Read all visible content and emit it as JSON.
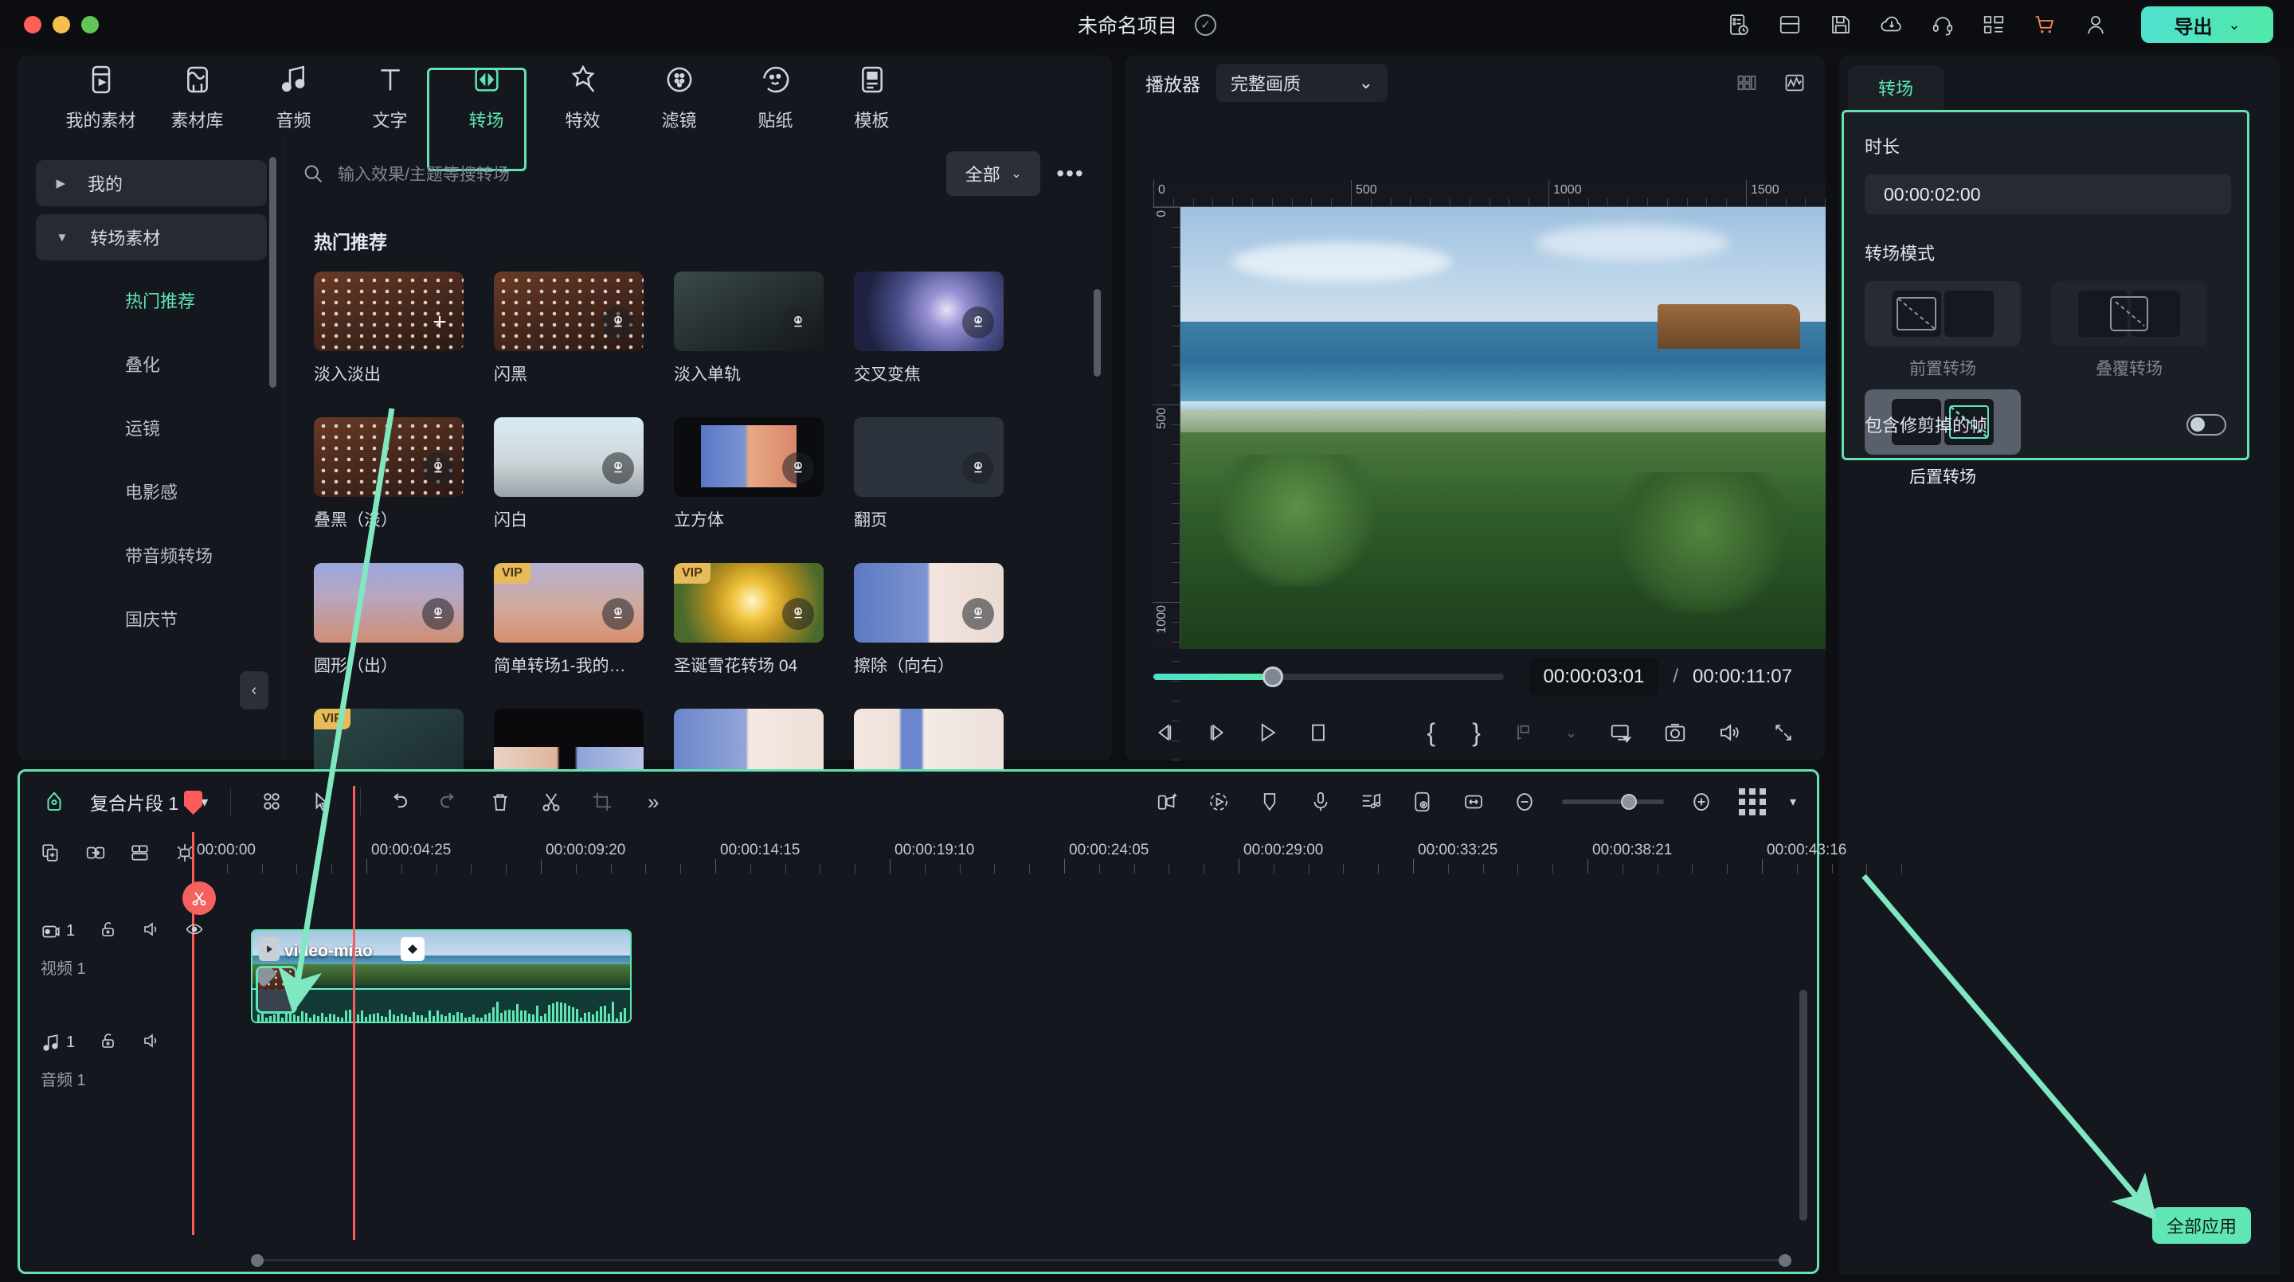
{
  "titlebar": {
    "project_name": "未命名项目",
    "check_icon": "check-circle-icon",
    "icons": [
      "task-history-icon",
      "layout-icon",
      "save-icon",
      "cloud-upload-icon",
      "headset-support-icon",
      "apps-grid-icon",
      "shopping-cart-icon",
      "user-account-icon"
    ],
    "export_label": "导出",
    "export_chevron": "⌄"
  },
  "tabs": [
    {
      "label": "我的素材",
      "icon": "my-media-icon",
      "active": false
    },
    {
      "label": "素材库",
      "icon": "stock-library-icon",
      "active": false
    },
    {
      "label": "音频",
      "icon": "audio-icon",
      "active": false
    },
    {
      "label": "文字",
      "icon": "text-icon",
      "active": false
    },
    {
      "label": "转场",
      "icon": "transition-icon",
      "active": true
    },
    {
      "label": "特效",
      "icon": "effects-icon",
      "active": false
    },
    {
      "label": "滤镜",
      "icon": "filter-icon",
      "active": false
    },
    {
      "label": "贴纸",
      "icon": "sticker-icon",
      "active": false
    },
    {
      "label": "模板",
      "icon": "template-icon",
      "active": false
    }
  ],
  "categories": {
    "group_mine": "我的",
    "group_transitions": "转场素材",
    "items": [
      {
        "label": "热门推荐",
        "active": true
      },
      {
        "label": "叠化",
        "active": false
      },
      {
        "label": "运镜",
        "active": false
      },
      {
        "label": "电影感",
        "active": false
      },
      {
        "label": "带音频转场",
        "active": false
      },
      {
        "label": "国庆节",
        "active": false
      }
    ]
  },
  "search": {
    "placeholder": "输入效果/主题等搜转场",
    "filter_label": "全部",
    "more_label": "•••"
  },
  "grid": {
    "section_title": "热门推荐",
    "items": [
      {
        "label": "淡入淡出",
        "art": "art-brown",
        "dots": true,
        "badge": "",
        "action": "plus"
      },
      {
        "label": "闪黑",
        "art": "art-brown",
        "dots": true,
        "badge": "",
        "action": "download"
      },
      {
        "label": "淡入单轨",
        "art": "art-dark",
        "dots": false,
        "badge": "",
        "action": "download"
      },
      {
        "label": "交叉变焦",
        "art": "art-zoom",
        "dots": false,
        "badge": "",
        "action": "download"
      },
      {
        "label": "叠黑（淡）",
        "art": "art-brown",
        "dots": true,
        "badge": "",
        "action": "download"
      },
      {
        "label": "闪白",
        "art": "art-white",
        "dots": false,
        "badge": "",
        "action": "download"
      },
      {
        "label": "立方体",
        "art": "art-cube",
        "dots": false,
        "badge": "",
        "action": "download"
      },
      {
        "label": "翻页",
        "art": "art-page",
        "dots": false,
        "badge": "",
        "action": "download"
      },
      {
        "label": "圆形（出）",
        "art": "art-mtn",
        "dots": false,
        "badge": "",
        "action": "download"
      },
      {
        "label": "简单转场1-我的…",
        "art": "art-mtn2",
        "dots": false,
        "badge": "VIP",
        "action": "download"
      },
      {
        "label": "圣诞雪花转场 04",
        "art": "art-gold",
        "dots": false,
        "badge": "VIP",
        "action": "download"
      },
      {
        "label": "擦除（向右）",
        "art": "art-split",
        "dots": false,
        "badge": "",
        "action": "download"
      },
      {
        "label": "",
        "art": "art-teal",
        "dots": false,
        "badge": "VIP",
        "action": ""
      },
      {
        "label": "",
        "art": "art-blk",
        "dots": false,
        "badge": "",
        "action": ""
      },
      {
        "label": "",
        "art": "art-split2",
        "dots": false,
        "badge": "",
        "action": ""
      },
      {
        "label": "",
        "art": "art-split3",
        "dots": false,
        "badge": "",
        "action": ""
      }
    ]
  },
  "player": {
    "title": "播放器",
    "quality": "完整画质",
    "quality_chevron": "⌄",
    "grid_view_icon": "grid-view-icon",
    "scope_icon": "waveform-scope-icon",
    "ruler_h_labels": [
      "0",
      "500",
      "1000",
      "1500"
    ],
    "ruler_v_labels": [
      "0",
      "500",
      "1000"
    ],
    "current_time": "00:00:03:01",
    "time_sep": "/",
    "total_time": "00:00:11:07",
    "controls": [
      {
        "icon": "prev-frame-icon"
      },
      {
        "icon": "next-frame-icon"
      },
      {
        "icon": "play-icon"
      },
      {
        "icon": "stop-icon"
      },
      {
        "icon": "mark-in-icon"
      },
      {
        "icon": "mark-out-icon"
      },
      {
        "icon": "snapshot-marker-icon"
      },
      {
        "icon": "chevron-down-icon"
      },
      {
        "icon": "display-mode-icon"
      },
      {
        "icon": "camera-icon"
      },
      {
        "icon": "volume-icon"
      },
      {
        "icon": "fullscreen-icon"
      }
    ]
  },
  "right_panel": {
    "tab_label": "转场",
    "duration_label": "时长",
    "duration_value": "00:00:02:00",
    "mode_label": "转场模式",
    "modes": [
      {
        "label": "前置转场",
        "selected": false,
        "enabled": false
      },
      {
        "label": "叠覆转场",
        "selected": false,
        "enabled": false
      },
      {
        "label": "后置转场",
        "selected": true,
        "enabled": true
      }
    ],
    "toggle_label": "包含修剪掉的帧",
    "toggle_on": false,
    "apply_all_label": "全部应用"
  },
  "timeline": {
    "clip_selector": "复合片段 1",
    "selector_chevron": "▾",
    "toolbar_left_icons": [
      "marker-icon",
      "select-tool-icon",
      "crop-pointer-icon"
    ],
    "toolbar_edit_icons": [
      "undo-icon",
      "redo-icon",
      "delete-icon",
      "split-scissors-icon",
      "crop-icon",
      "more-chevrons-icon"
    ],
    "toolbar_right_icons": [
      "auto-cut-icon",
      "speed-icon",
      "mask-icon",
      "voiceover-icon",
      "audio-mix-icon",
      "motion-track-icon",
      "fit-to-window-icon"
    ],
    "zoom_out_icon": "zoom-out-icon",
    "zoom_in_icon": "zoom-in-icon",
    "grid_menu_icon": "grid-menu-icon",
    "track_tools": [
      "add-track-icon",
      "link-icon",
      "group-icon",
      "snap-icon"
    ],
    "ruler_labels": [
      "00:00:00",
      "00:00:04:25",
      "00:00:09:20",
      "00:00:14:15",
      "00:00:19:10",
      "00:00:24:05",
      "00:00:29:00",
      "00:00:33:25",
      "00:00:38:21",
      "00:00:43:16"
    ],
    "tracks": [
      {
        "name": "视频 1",
        "num": "1",
        "type": "video",
        "icons": [
          "video-track-icon",
          "lock-icon",
          "mute-icon",
          "visibility-icon"
        ]
      },
      {
        "name": "音频 1",
        "num": "1",
        "type": "audio",
        "icons": [
          "audio-track-icon",
          "lock-icon",
          "mute-icon"
        ]
      }
    ],
    "clip": {
      "name": "video-miao"
    }
  },
  "colors": {
    "accent": "#5fe6b4",
    "playhead": "#ff5b5b",
    "panel_bg": "#14171d",
    "app_bg": "#0d0f13",
    "vip_badge": "#e8bb5a"
  }
}
